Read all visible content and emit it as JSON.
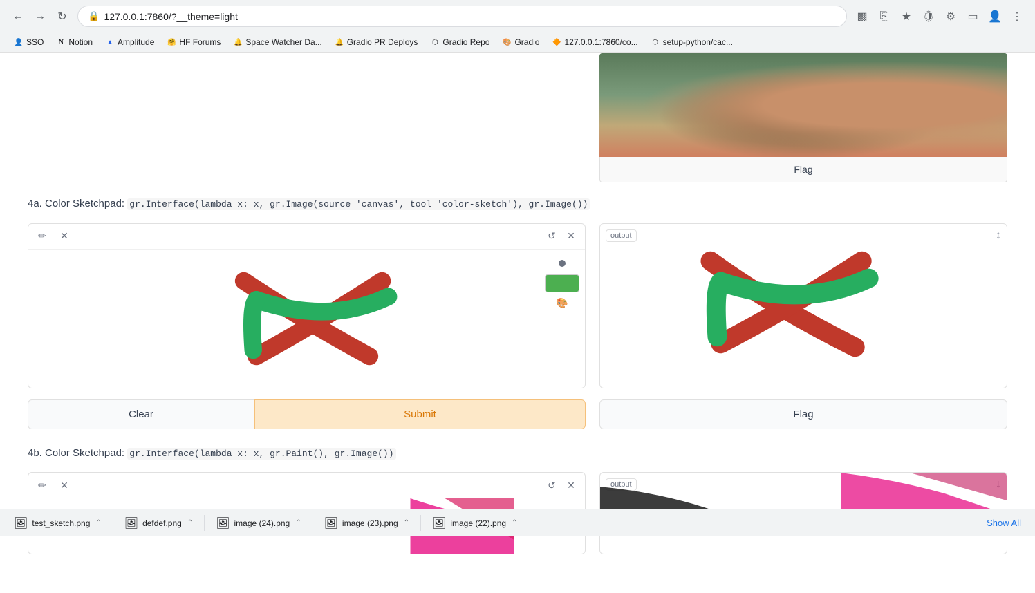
{
  "browser": {
    "url": "127.0.0.1:7860/?__theme=light",
    "back_btn": "←",
    "forward_btn": "→",
    "refresh_btn": "↻"
  },
  "bookmarks": [
    {
      "id": "sso",
      "label": "SSO",
      "icon": "👤"
    },
    {
      "id": "notion",
      "label": "Notion",
      "icon": "N"
    },
    {
      "id": "amplitude",
      "label": "Amplitude",
      "icon": "▲"
    },
    {
      "id": "hf-forums",
      "label": "HF Forums",
      "icon": "🤗"
    },
    {
      "id": "space-watcher",
      "label": "Space Watcher Da...",
      "icon": "🔔"
    },
    {
      "id": "gradio-pr",
      "label": "Gradio PR Deploys",
      "icon": "🔔"
    },
    {
      "id": "gradio-repo",
      "label": "Gradio Repo",
      "icon": "⬡"
    },
    {
      "id": "gradio",
      "label": "Gradio",
      "icon": "🎨"
    },
    {
      "id": "localhost-co",
      "label": "127.0.0.1:7860/co...",
      "icon": "🔶"
    },
    {
      "id": "setup-python",
      "label": "setup-python/cac...",
      "icon": "⬡"
    }
  ],
  "top_flag_button": "Flag",
  "section_4a": {
    "label": "4a. Color Sketchpad:",
    "code": "gr.Interface(lambda x: x, gr.Image(source='canvas', tool='color-sketch'), gr.Image())"
  },
  "canvas_toolbar": {
    "pencil_icon": "✏",
    "close_icon": "×",
    "reset_icon": "↺",
    "delete_icon": "×"
  },
  "output_label": "output",
  "color_swatch_color": "#4caf50",
  "buttons": {
    "clear": "Clear",
    "submit": "Submit",
    "flag": "Flag"
  },
  "section_4b": {
    "label": "4b. Color Sketchpad:",
    "code": "gr.Interface(lambda x: x, gr.Paint(), gr.Image())"
  },
  "output_label_4b": "output",
  "downloads": [
    {
      "id": "test-sketch",
      "name": "test_sketch.png",
      "icon": "🖼"
    },
    {
      "id": "defdef",
      "name": "defdef.png",
      "icon": "🖼"
    },
    {
      "id": "image-24",
      "name": "image (24).png",
      "icon": "🖼"
    },
    {
      "id": "image-23",
      "name": "image (23).png",
      "icon": "🖼"
    },
    {
      "id": "image-22",
      "name": "image (22).png",
      "icon": "🖼"
    }
  ],
  "show_all": "Show All"
}
